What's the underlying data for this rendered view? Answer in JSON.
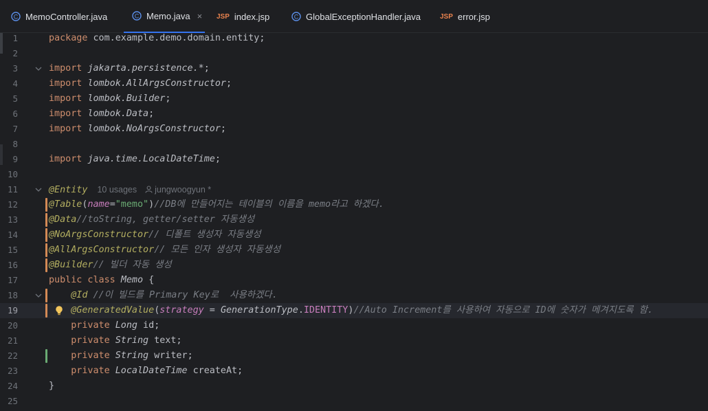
{
  "tabs": [
    {
      "label": "MemoController.java",
      "icon": "class-icon",
      "active": false
    },
    {
      "label": "Memo.java",
      "icon": "class-icon",
      "active": true,
      "close": "×"
    },
    {
      "label": "index.jsp",
      "icon": "jsp-icon",
      "active": false
    },
    {
      "label": "GlobalExceptionHandler.java",
      "icon": "class-icon",
      "active": false
    },
    {
      "label": "error.jsp",
      "icon": "jsp-icon",
      "active": false
    }
  ],
  "jsp_badge": "JSP",
  "hint": {
    "usages": "10 usages",
    "author": "jungwoogyun *"
  },
  "lines": [
    {
      "n": "1",
      "parts": [
        [
          "k",
          "package "
        ],
        [
          "pk",
          "com.example.demo.domain.entity"
        ],
        [
          "pk",
          ";"
        ]
      ]
    },
    {
      "n": "2",
      "parts": []
    },
    {
      "n": "3",
      "parts": [
        [
          "k",
          "import "
        ],
        [
          "it",
          "jakarta.persistence.*"
        ],
        [
          "pk",
          ";"
        ]
      ]
    },
    {
      "n": "4",
      "parts": [
        [
          "k",
          "import "
        ],
        [
          "it",
          "lombok.AllArgsConstructor"
        ],
        [
          "pk",
          ";"
        ]
      ]
    },
    {
      "n": "5",
      "parts": [
        [
          "k",
          "import "
        ],
        [
          "it",
          "lombok.Builder"
        ],
        [
          "pk",
          ";"
        ]
      ]
    },
    {
      "n": "6",
      "parts": [
        [
          "k",
          "import "
        ],
        [
          "it",
          "lombok.Data"
        ],
        [
          "pk",
          ";"
        ]
      ]
    },
    {
      "n": "7",
      "parts": [
        [
          "k",
          "import "
        ],
        [
          "it",
          "lombok.NoArgsConstructor"
        ],
        [
          "pk",
          ";"
        ]
      ]
    },
    {
      "n": "8",
      "parts": []
    },
    {
      "n": "9",
      "parts": [
        [
          "k",
          "import "
        ],
        [
          "it",
          "java.time.LocalDateTime"
        ],
        [
          "pk",
          ";"
        ]
      ]
    },
    {
      "n": "10",
      "parts": []
    },
    {
      "n": "11",
      "parts": [
        [
          "an",
          "@Entity"
        ]
      ]
    },
    {
      "n": "12",
      "parts": [
        [
          "an",
          "@Table"
        ],
        [
          "pk",
          "("
        ],
        [
          "pm",
          "name"
        ],
        [
          "pk",
          "="
        ],
        [
          "st",
          "\"memo\""
        ],
        [
          "pk",
          ")"
        ],
        [
          "cm",
          "//DB에 만들어지는 테이블의 이름을 memo라고 하겠다."
        ]
      ]
    },
    {
      "n": "13",
      "parts": [
        [
          "an",
          "@Data"
        ],
        [
          "cm",
          "//toString, getter/setter 자동생성"
        ]
      ]
    },
    {
      "n": "14",
      "parts": [
        [
          "an",
          "@NoArgsConstructor"
        ],
        [
          "cm",
          "// 디폴트 생성자 자동생성"
        ]
      ]
    },
    {
      "n": "15",
      "parts": [
        [
          "an",
          "@AllArgsConstructor"
        ],
        [
          "cm",
          "// 모든 인자 생성자 자동생성"
        ]
      ]
    },
    {
      "n": "16",
      "parts": [
        [
          "an",
          "@Builder"
        ],
        [
          "cm",
          "// 빌더 자동 생성"
        ]
      ]
    },
    {
      "n": "17",
      "parts": [
        [
          "k",
          "public class "
        ],
        [
          "ty",
          "Memo"
        ],
        [
          "pk",
          " {"
        ]
      ]
    },
    {
      "n": "18",
      "parts": [
        [
          "pk",
          "    "
        ],
        [
          "an",
          "@Id"
        ],
        [
          "cm",
          " //이 빌드를 Primary Key로  사용하겠다."
        ]
      ]
    },
    {
      "n": "19",
      "parts": [
        [
          "pk",
          "    "
        ],
        [
          "an",
          "@GeneratedValue"
        ],
        [
          "pk",
          "("
        ],
        [
          "pm",
          "strategy"
        ],
        [
          "pk",
          " = "
        ],
        [
          "ty",
          "GenerationType"
        ],
        [
          "pk",
          "."
        ],
        [
          "ct",
          "IDENTITY"
        ],
        [
          "pk",
          ")"
        ],
        [
          "cm",
          "//Auto Increment를 사용하여 자동으로 ID에 숫자가 메겨지도록 함."
        ]
      ]
    },
    {
      "n": "20",
      "parts": [
        [
          "pk",
          "    "
        ],
        [
          "k",
          "private "
        ],
        [
          "ty",
          "Long"
        ],
        [
          "fd",
          " id"
        ],
        [
          "pk",
          ";"
        ]
      ]
    },
    {
      "n": "21",
      "parts": [
        [
          "pk",
          "    "
        ],
        [
          "k",
          "private "
        ],
        [
          "ty",
          "String"
        ],
        [
          "fd",
          " text"
        ],
        [
          "pk",
          ";"
        ]
      ]
    },
    {
      "n": "22",
      "parts": [
        [
          "pk",
          "    "
        ],
        [
          "k",
          "private "
        ],
        [
          "ty",
          "String"
        ],
        [
          "fd",
          " writer"
        ],
        [
          "pk",
          ";"
        ]
      ]
    },
    {
      "n": "23",
      "parts": [
        [
          "pk",
          "    "
        ],
        [
          "k",
          "private "
        ],
        [
          "ty",
          "LocalDateTime"
        ],
        [
          "fd",
          " createAt"
        ],
        [
          "pk",
          ";"
        ]
      ]
    },
    {
      "n": "24",
      "parts": [
        [
          "pk",
          "}"
        ]
      ]
    },
    {
      "n": "25",
      "parts": []
    }
  ],
  "colors": {
    "accent": "#3574f0",
    "modified": "#d48a55",
    "added": "#6aab73"
  }
}
